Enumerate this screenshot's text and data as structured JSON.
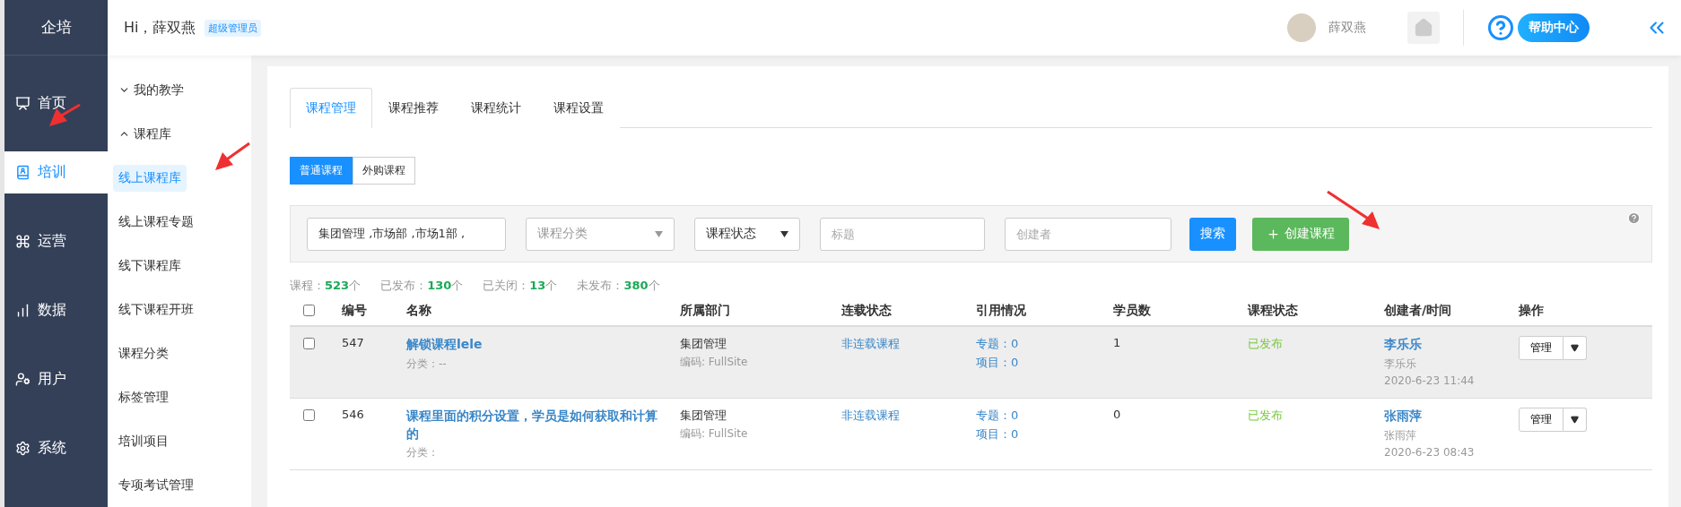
{
  "brand": "企培",
  "nav": [
    {
      "label": "首页",
      "selected": false
    },
    {
      "label": "培训",
      "selected": true
    },
    {
      "label": "运营",
      "selected": false
    },
    {
      "label": "数据",
      "selected": false
    },
    {
      "label": "用户",
      "selected": false
    },
    {
      "label": "系统",
      "selected": false
    }
  ],
  "subnav": [
    {
      "label": "我的教学",
      "expanded": false
    },
    {
      "label": "课程库",
      "expanded": true,
      "children": [
        {
          "label": "线上课程库",
          "selected": true
        },
        {
          "label": "线上课程专题",
          "selected": false
        },
        {
          "label": "线下课程库",
          "selected": false
        },
        {
          "label": "线下课程开班",
          "selected": false
        },
        {
          "label": "课程分类",
          "selected": false
        },
        {
          "label": "标签管理",
          "selected": false
        },
        {
          "label": "培训项目",
          "selected": false
        },
        {
          "label": "专项考试管理",
          "selected": false
        }
      ]
    }
  ],
  "header": {
    "greeting": "Hi，薛双燕",
    "role_badge": "超级管理员",
    "user_name": "薛双燕",
    "help": "帮助中心"
  },
  "tabs": [
    {
      "label": "课程管理",
      "selected": true
    },
    {
      "label": "课程推荐",
      "selected": false
    },
    {
      "label": "课程统计",
      "selected": false
    },
    {
      "label": "课程设置",
      "selected": false
    }
  ],
  "course_types": [
    {
      "label": "普通课程",
      "selected": true
    },
    {
      "label": "外购课程",
      "selected": false
    }
  ],
  "filters": {
    "department": "集团管理 ,市场部 ,市场1部 ,",
    "category_placeholder": "课程分类",
    "status": "课程状态",
    "title_placeholder": "标题",
    "creator_placeholder": "创建者",
    "search_button": "搜索",
    "create_button": "创建课程"
  },
  "stats": [
    {
      "label": "课程：",
      "value": "523",
      "unit": "个"
    },
    {
      "label": "已发布：",
      "value": "130",
      "unit": "个"
    },
    {
      "label": "已关闭：",
      "value": "13",
      "unit": "个"
    },
    {
      "label": "未发布：",
      "value": "380",
      "unit": "个"
    }
  ],
  "table": {
    "all_checked": false,
    "columns": [
      "编号",
      "名称",
      "所属部门",
      "连载状态",
      "引用情况",
      "学员数",
      "课程状态",
      "创建者/时间",
      "操作"
    ],
    "rows": [
      {
        "checked": false,
        "hovered": true,
        "id": "547",
        "name": "解锁课程lele",
        "category": "分类：--",
        "department": "集团管理",
        "code": "编码: FullSite",
        "serial": "非连载课程",
        "topics": "专题：0",
        "projects": "项目：0",
        "students": "1",
        "status": "已发布",
        "creator": "李乐乐",
        "creator_account": "李乐乐",
        "time": "2020-6-23 11:44",
        "action": "管理"
      },
      {
        "checked": false,
        "hovered": false,
        "id": "546",
        "name": "课程里面的积分设置，学员是如何获取和计算的",
        "category": "分类：",
        "department": "集团管理",
        "code": "编码: FullSite",
        "serial": "非连载课程",
        "topics": "专题：0",
        "projects": "项目：0",
        "students": "0",
        "status": "已发布",
        "creator": "张雨萍",
        "creator_account": "张雨萍",
        "time": "2020-6-23 08:43",
        "action": "管理"
      }
    ]
  }
}
